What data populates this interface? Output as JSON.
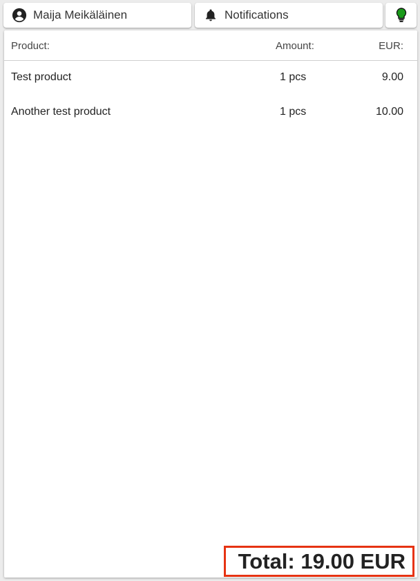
{
  "topbar": {
    "user_label": "Maija Meikäläinen",
    "notifications_label": "Notifications"
  },
  "table": {
    "headers": {
      "product": "Product:",
      "amount": "Amount:",
      "eur": "EUR:"
    },
    "rows": [
      {
        "product": "Test product",
        "amount": "1 pcs",
        "eur": "9.00"
      },
      {
        "product": "Another test product",
        "amount": "1 pcs",
        "eur": "10.00"
      }
    ]
  },
  "total": {
    "text": "Total: 19.00 EUR"
  },
  "colors": {
    "bulb": "#1a9a1a",
    "highlight_border": "#e63312"
  }
}
